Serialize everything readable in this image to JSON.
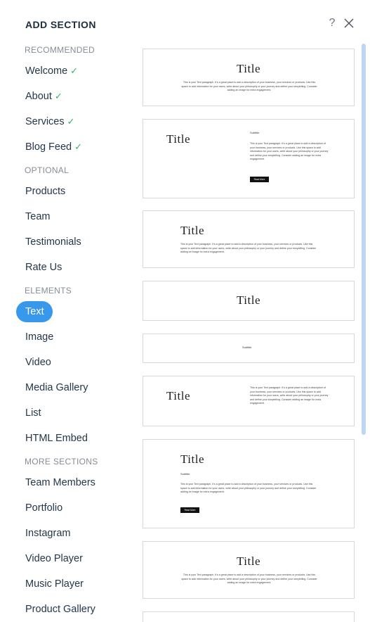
{
  "header": {
    "title": "ADD SECTION",
    "help_label": "?"
  },
  "sidebar": {
    "categories": [
      "RECOMMENDED",
      "OPTIONAL",
      "ELEMENTS",
      "MORE SECTIONS"
    ],
    "recommended": [
      {
        "label": "Welcome",
        "check": "✓"
      },
      {
        "label": "About",
        "check": "✓"
      },
      {
        "label": "Services",
        "check": "✓"
      },
      {
        "label": "Blog Feed",
        "check": "✓"
      }
    ],
    "optional": [
      "Products",
      "Team",
      "Testimonials",
      "Rate Us"
    ],
    "elements": [
      "Text",
      "Image",
      "Video",
      "Media Gallery",
      "List",
      "HTML Embed"
    ],
    "more": [
      "Team Members",
      "Portfolio",
      "Instagram",
      "Video Player",
      "Music Player",
      "Product Gallery"
    ],
    "selected": "Text"
  },
  "previews": {
    "title_text": "Title",
    "subtitle_text": "Subtitle",
    "button_text": "Read More",
    "paragraph_text": "This is your Text paragraph. It's a great place to add a description of your business, your services or products. Use this space to add information for your users, write about your philosophy or your journey and define your storytelling. Consider adding an image for extra engagement."
  },
  "colors": {
    "accent": "#3899ec",
    "check": "#2db670",
    "category": "#868d96",
    "scrollbar": "#bcd7f3"
  },
  "icons": {
    "help": "question-mark-icon",
    "close": "close-icon",
    "check": "checkmark-icon"
  }
}
